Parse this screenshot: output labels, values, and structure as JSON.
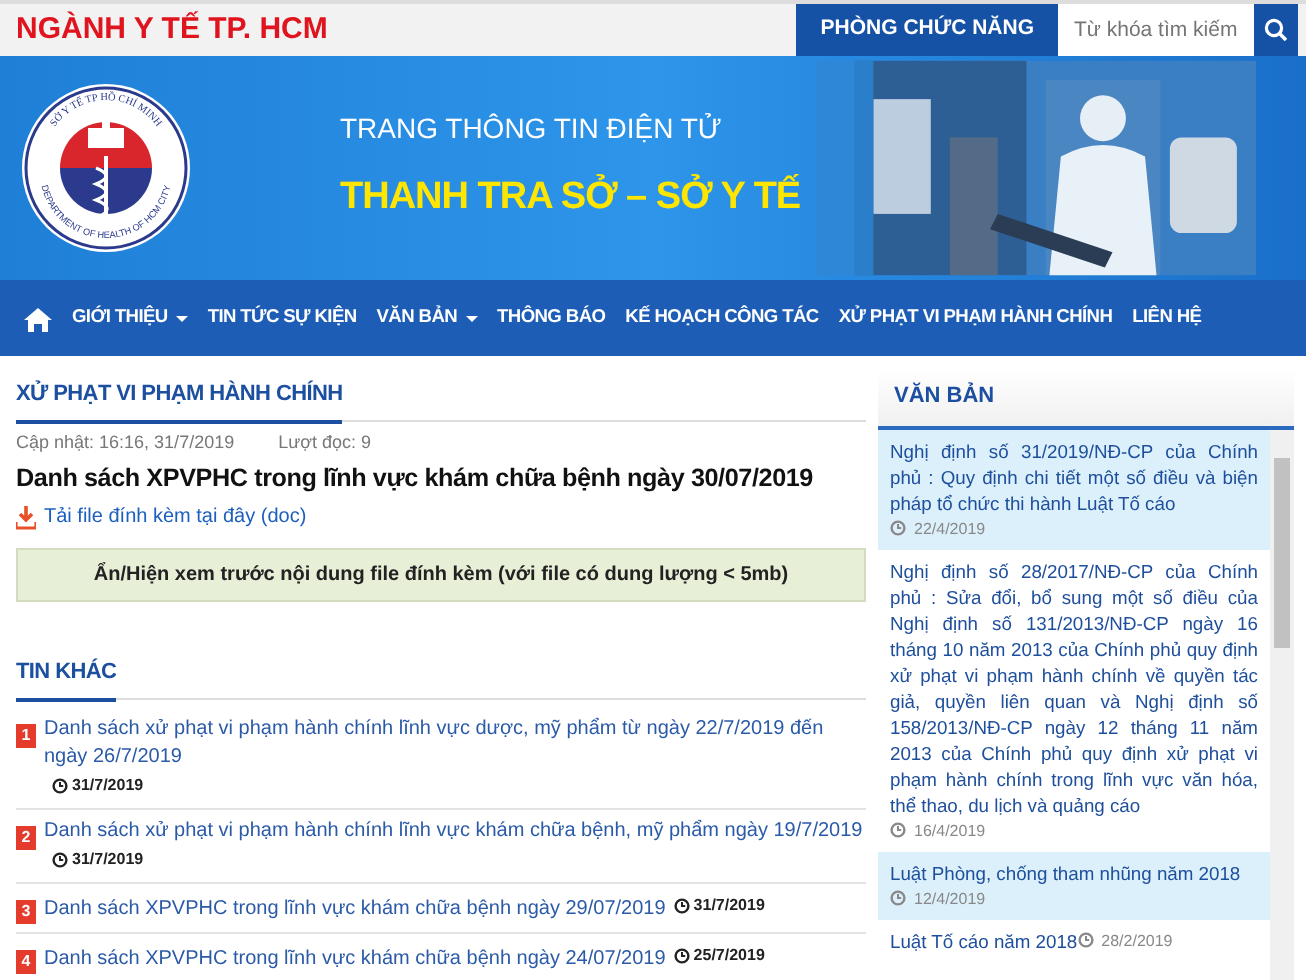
{
  "header": {
    "site_name": "NGÀNH Y TẾ TP. HCM",
    "functions_button": "PHÒNG CHỨC NĂNG",
    "search": {
      "placeholder": "Từ khóa tìm kiếm"
    }
  },
  "banner": {
    "logo": {
      "ring_top": "SỞ Y TẾ TP HỒ CHÍ MINH",
      "ring_bottom": "DEPARTMENT OF HEALTH OF HCM CITY"
    },
    "subtitle": "TRANG THÔNG TIN ĐIỆN TỬ",
    "title": "THANH TRA SỞ – SỞ Y TẾ"
  },
  "nav": [
    {
      "label": "GIỚI THIỆU",
      "dropdown": true
    },
    {
      "label": "TIN TỨC SỰ KIỆN",
      "dropdown": false
    },
    {
      "label": "VĂN BẢN",
      "dropdown": true
    },
    {
      "label": "THÔNG BÁO",
      "dropdown": false
    },
    {
      "label": "KẾ HOẠCH CÔNG TÁC",
      "dropdown": false
    },
    {
      "label": "XỬ PHẠT VI PHẠM HÀNH CHÍNH",
      "dropdown": false
    },
    {
      "label": "LIÊN HỆ",
      "dropdown": false
    }
  ],
  "article": {
    "section": "XỬ PHẠT VI PHẠM HÀNH CHÍNH",
    "updated": "Cập nhật: 16:16, 31/7/2019",
    "views": "Lượt đọc: 9",
    "title": "Danh sách XPVPHC trong lĩnh vực khám chữa bệnh ngày 30/07/2019",
    "attachment": "Tải file đính kèm tại đây (doc)",
    "preview_toggle": "Ẩn/Hiện xem trước nội dung file đính kèm (với file có dung lượng < 5mb)"
  },
  "other_news": {
    "title": "TIN KHÁC",
    "items": [
      {
        "number": "1",
        "title": "Danh sách xử phạt vi phạm hành chính lĩnh vực dược, mỹ phẩm từ ngày 22/7/2019 đến ngày 26/7/2019",
        "date": "31/7/2019"
      },
      {
        "number": "2",
        "title": "Danh sách xử phạt vi phạm hành chính lĩnh vực khám chữa bệnh, mỹ phẩm ngày 19/7/2019",
        "date": "31/7/2019"
      },
      {
        "number": "3",
        "title": "Danh sách XPVPHC trong lĩnh vực khám chữa bệnh ngày 29/07/2019",
        "date": "31/7/2019"
      },
      {
        "number": "4",
        "title": "Danh sách XPVPHC trong lĩnh vực khám chữa bệnh ngày 24/07/2019",
        "date": "25/7/2019"
      }
    ]
  },
  "sidebar": {
    "title": "VĂN BẢN",
    "items": [
      {
        "title": "Nghị định số 31/2019/NĐ-CP của Chính phủ : Quy định chi tiết một số điều và biện pháp tổ chức thi hành Luật Tố cáo",
        "date": "22/4/2019",
        "highlighted": true
      },
      {
        "title": "Nghị định số 28/2017/NĐ-CP của Chính phủ : Sửa đổi, bổ sung một số điều của Nghị định số 131/2013/NĐ-CP ngày 16 tháng 10 năm 2013 của Chính phủ quy định xử phạt vi phạm hành chính về quyền tác giả, quyền liên quan và Nghị định số 158/2013/NĐ-CP ngày 12 tháng 11 năm 2013 của Chính phủ quy định xử phạt vi phạm hành chính trong lĩnh vực văn hóa, thể thao, du lịch và quảng cáo",
        "date": "16/4/2019",
        "highlighted": false
      },
      {
        "title": "Luật Phòng, chống tham nhũng năm 2018",
        "date": "12/4/2019",
        "highlighted": true
      },
      {
        "title": "Luật Tố cáo năm 2018",
        "date": "28/2/2019",
        "highlighted": false
      }
    ]
  }
}
